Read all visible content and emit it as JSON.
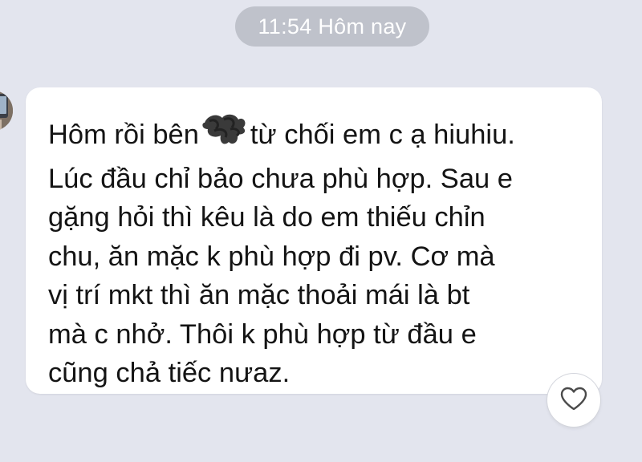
{
  "timestamp": "11:54 Hôm nay",
  "message": {
    "line1_before": "Hôm rồi bên",
    "line1_after": "từ chối em c ạ hiuhiu.",
    "lines": [
      "Lúc đầu chỉ bảo chưa phù hợp. Sau e",
      "gặng hỏi thì kêu là do em thiếu chỉn",
      "chu, ăn mặc k phù hợp đi pv. Cơ mà",
      "vị trí mkt thì ăn mặc thoải mái là bt",
      "mà c nhở. Thôi k phù hợp từ đầu e",
      "cũng chả tiếc nưaz."
    ]
  },
  "icons": {
    "avatar": "avatar-photo",
    "redaction": "scribble-redaction",
    "react": "heart-outline-icon"
  },
  "colors": {
    "background": "#e3e5ee",
    "bubble": "#ffffff",
    "timestamp_pill": "#bfc2cb",
    "text": "#141414"
  }
}
